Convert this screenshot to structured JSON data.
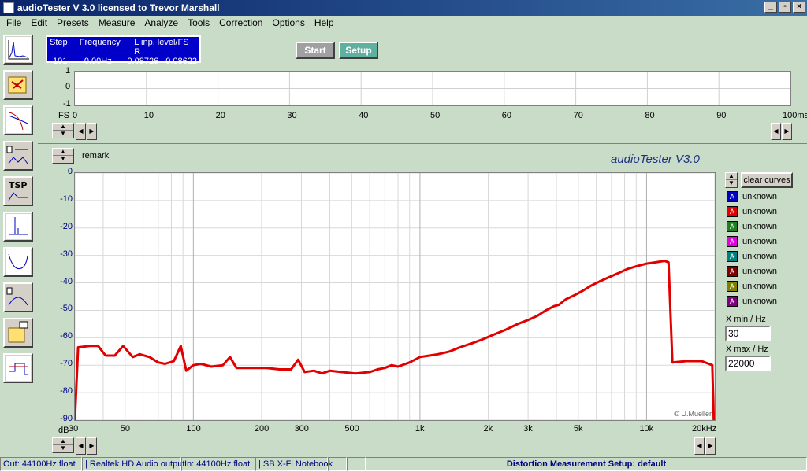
{
  "window": {
    "title": "audioTester  V 3.0   licensed to Trevor Marshall"
  },
  "menu": [
    "File",
    "Edit",
    "Presets",
    "Measure",
    "Analyze",
    "Tools",
    "Correction",
    "Options",
    "Help"
  ],
  "info": {
    "h_step": "Step",
    "h_freq": "Frequency",
    "h_level": "L  inp. level/FS  R",
    "step": "101",
    "freq": "0.00Hz",
    "l": "0.08726",
    "r": "0.08622"
  },
  "buttons": {
    "start": "Start",
    "setup": "Setup",
    "clear": "clear curves"
  },
  "scope": {
    "y_ticks": [
      "1",
      "0",
      "-1"
    ],
    "fs_label": "FS",
    "x_ticks": [
      "0",
      "10",
      "20",
      "30",
      "40",
      "50",
      "60",
      "70",
      "80",
      "90",
      "100ms"
    ]
  },
  "main": {
    "remark": "remark",
    "brand": "audioTester  V3.0",
    "credit": "© U.Mueller",
    "db_unit": "dB"
  },
  "legend": [
    {
      "label": "unknown",
      "color": "#0000c0"
    },
    {
      "label": "unknown",
      "color": "#e00000"
    },
    {
      "label": "unknown",
      "color": "#208020"
    },
    {
      "label": "unknown",
      "color": "#e000e0"
    },
    {
      "label": "unknown",
      "color": "#008080"
    },
    {
      "label": "unknown",
      "color": "#800000"
    },
    {
      "label": "unknown",
      "color": "#808000"
    },
    {
      "label": "unknown",
      "color": "#800080"
    }
  ],
  "xrange": {
    "min_label": "X min / Hz",
    "min": "30",
    "max_label": "X max / Hz",
    "max": "22000"
  },
  "status": {
    "out": "Out: 44100Hz float",
    "out_dev": "Realtek HD Audio output",
    "in": "In: 44100Hz float",
    "in_dev": "SB X-Fi Notebook",
    "setup": "Distortion Measurement Setup:  default"
  },
  "chart_data": {
    "type": "line",
    "xscale": "log",
    "xlim": [
      30,
      20000
    ],
    "ylim": [
      -90,
      0
    ],
    "x_tick_labels": [
      "30",
      "50",
      "100",
      "200",
      "300",
      "500",
      "1k",
      "2k",
      "3k",
      "5k",
      "10k",
      "20kHz"
    ],
    "x_tick_values": [
      30,
      50,
      100,
      200,
      300,
      500,
      1000,
      2000,
      3000,
      5000,
      10000,
      20000
    ],
    "y_ticks": [
      0,
      -10,
      -20,
      -30,
      -40,
      -50,
      -60,
      -70,
      -80,
      -90
    ],
    "series": [
      {
        "color": "#e00000",
        "points": [
          [
            30,
            -90
          ],
          [
            31,
            -63.5
          ],
          [
            35,
            -63
          ],
          [
            38,
            -63
          ],
          [
            41,
            -66.5
          ],
          [
            45,
            -66.5
          ],
          [
            49,
            -63
          ],
          [
            54,
            -67
          ],
          [
            58,
            -66
          ],
          [
            64,
            -67
          ],
          [
            70,
            -69
          ],
          [
            75,
            -69.5
          ],
          [
            82,
            -68.5
          ],
          [
            88,
            -63
          ],
          [
            93,
            -72
          ],
          [
            100,
            -70
          ],
          [
            108,
            -69.5
          ],
          [
            120,
            -70.5
          ],
          [
            135,
            -70
          ],
          [
            145,
            -67
          ],
          [
            155,
            -71
          ],
          [
            175,
            -71
          ],
          [
            210,
            -71
          ],
          [
            240,
            -71.5
          ],
          [
            270,
            -71.5
          ],
          [
            290,
            -68
          ],
          [
            310,
            -72.5
          ],
          [
            340,
            -72
          ],
          [
            370,
            -73
          ],
          [
            400,
            -72
          ],
          [
            450,
            -72.5
          ],
          [
            520,
            -73
          ],
          [
            600,
            -72.5
          ],
          [
            650,
            -71.5
          ],
          [
            700,
            -71
          ],
          [
            750,
            -70
          ],
          [
            800,
            -70.5
          ],
          [
            900,
            -69
          ],
          [
            1000,
            -67
          ],
          [
            1100,
            -66.5
          ],
          [
            1200,
            -66
          ],
          [
            1350,
            -65
          ],
          [
            1500,
            -63.5
          ],
          [
            1700,
            -62
          ],
          [
            1900,
            -60.5
          ],
          [
            2100,
            -59
          ],
          [
            2400,
            -57
          ],
          [
            2700,
            -55
          ],
          [
            3000,
            -53.5
          ],
          [
            3300,
            -52
          ],
          [
            3600,
            -50
          ],
          [
            3900,
            -48.5
          ],
          [
            4100,
            -48
          ],
          [
            4400,
            -46
          ],
          [
            4800,
            -44.5
          ],
          [
            5200,
            -43
          ],
          [
            5700,
            -41
          ],
          [
            6200,
            -39.5
          ],
          [
            6800,
            -38
          ],
          [
            7500,
            -36.5
          ],
          [
            8200,
            -35
          ],
          [
            9000,
            -34
          ],
          [
            10000,
            -33
          ],
          [
            11000,
            -32.5
          ],
          [
            12000,
            -32
          ],
          [
            12500,
            -32.5
          ],
          [
            13000,
            -69
          ],
          [
            15000,
            -68.5
          ],
          [
            17500,
            -68.5
          ],
          [
            19500,
            -70
          ],
          [
            19800,
            -90
          ],
          [
            22000,
            -90
          ]
        ]
      }
    ]
  }
}
